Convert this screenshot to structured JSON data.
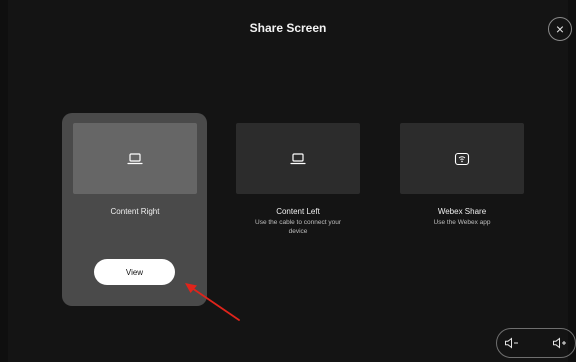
{
  "header": {
    "title": "Share Screen",
    "close_symbol": "×"
  },
  "sources": [
    {
      "title": "Content Right",
      "subtitle": "",
      "icon": "laptop-icon",
      "selected": true
    },
    {
      "title": "Content Left",
      "subtitle": "Use the cable to connect your device",
      "icon": "laptop-icon",
      "selected": false
    },
    {
      "title": "Webex Share",
      "subtitle": "Use the Webex app",
      "icon": "wireless-share-icon",
      "selected": false
    }
  ],
  "actions": {
    "view_label": "View"
  },
  "volume": {
    "decrease_icon": "volume-down-icon",
    "increase_icon": "volume-up-icon"
  },
  "colors": {
    "background": "#141414",
    "selected_card": "#4a4a4a",
    "unselected_tile": "#2c2c2c",
    "annotation_arrow": "#e0241b"
  }
}
